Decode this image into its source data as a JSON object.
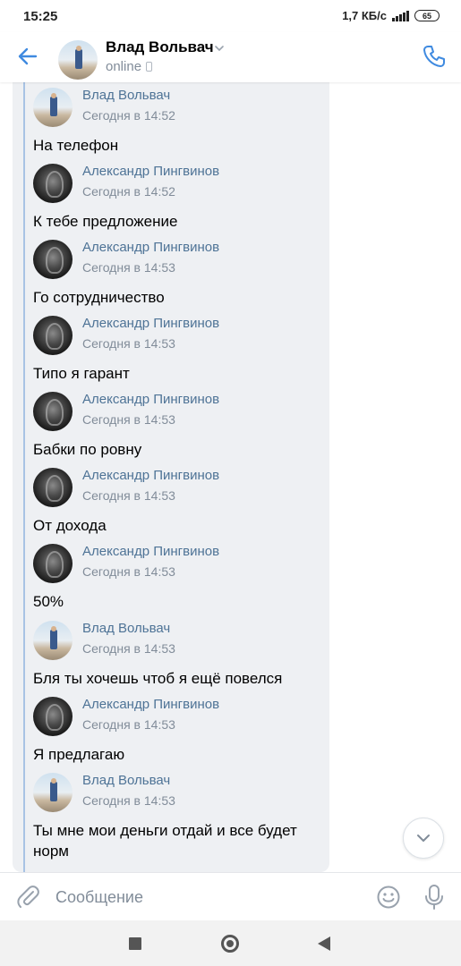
{
  "status_bar": {
    "time": "15:25",
    "speed": "1,7 КБ/с",
    "battery": "65"
  },
  "header": {
    "name": "Влад Вольвач",
    "status": "online"
  },
  "messages": [
    {
      "author": "Влад Вольвач",
      "time": "Сегодня в 14:52",
      "text": "На телефон",
      "avatar": "vlad"
    },
    {
      "author": "Александр Пингвинов",
      "time": "Сегодня в 14:52",
      "text": "К тебе предложение",
      "avatar": "alex"
    },
    {
      "author": "Александр Пингвинов",
      "time": "Сегодня в 14:53",
      "text": "Го сотрудничество",
      "avatar": "alex"
    },
    {
      "author": "Александр Пингвинов",
      "time": "Сегодня в 14:53",
      "text": "Типо я гарант",
      "avatar": "alex"
    },
    {
      "author": "Александр Пингвинов",
      "time": "Сегодня в 14:53",
      "text": "Бабки по ровну",
      "avatar": "alex"
    },
    {
      "author": "Александр Пингвинов",
      "time": "Сегодня в 14:53",
      "text": "От дохода",
      "avatar": "alex"
    },
    {
      "author": "Александр Пингвинов",
      "time": "Сегодня в 14:53",
      "text": "50%",
      "avatar": "alex"
    },
    {
      "author": "Влад Вольвач",
      "time": "Сегодня в 14:53",
      "text": "Бля ты хочешь чтоб я ещё повелся",
      "avatar": "vlad"
    },
    {
      "author": "Александр Пингвинов",
      "time": "Сегодня в 14:53",
      "text": "Я предлагаю",
      "avatar": "alex"
    },
    {
      "author": "Влад Вольвач",
      "time": "Сегодня в 14:53",
      "text": "Ты мне мои деньги отдай и все будет норм",
      "avatar": "vlad"
    }
  ],
  "composer": {
    "placeholder": "Сообщение"
  },
  "colors": {
    "accent": "#3f8ae0",
    "author_name": "#4e7396",
    "secondary_text": "#818c99",
    "forward_bg": "#eef0f3"
  }
}
